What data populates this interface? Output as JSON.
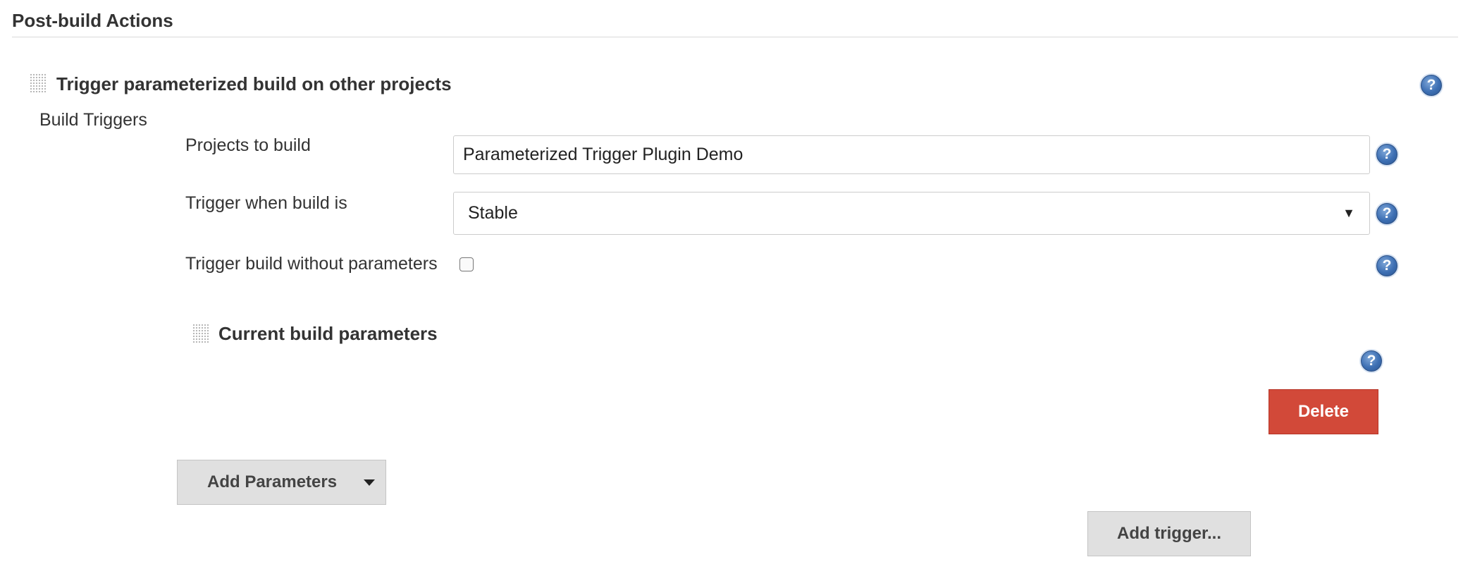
{
  "section": {
    "title": "Post-build Actions"
  },
  "trigger_block": {
    "title": "Trigger parameterized build on other projects",
    "build_triggers_label": "Build Triggers",
    "projects_to_build": {
      "label": "Projects to build",
      "value": "Parameterized Trigger Plugin Demo"
    },
    "trigger_when": {
      "label": "Trigger when build is",
      "selected": "Stable"
    },
    "without_params": {
      "label": "Trigger build without parameters",
      "checked": false
    },
    "current_params": {
      "title": "Current build parameters"
    },
    "delete_label": "Delete",
    "add_parameters_label": "Add Parameters",
    "add_trigger_label": "Add trigger..."
  },
  "help_glyph": "?",
  "select_caret": "▼",
  "colors": {
    "delete": "#d24939",
    "help": "#3d6fb3",
    "grey_button": "#e0e0e0"
  }
}
